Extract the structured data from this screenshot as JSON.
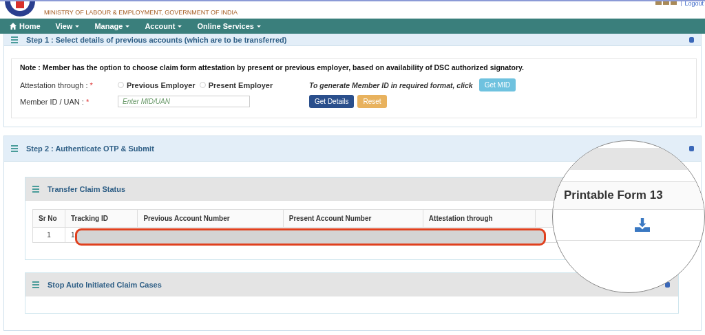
{
  "header": {
    "ministry": "MINISTRY OF LABOUR & EMPLOYMENT, GOVERNMENT OF INDIA",
    "logout": "Logout"
  },
  "nav": [
    {
      "label": "Home",
      "kind": "home"
    },
    {
      "label": "View",
      "kind": "dropdown"
    },
    {
      "label": "Manage",
      "kind": "dropdown"
    },
    {
      "label": "Account",
      "kind": "dropdown"
    },
    {
      "label": "Online Services",
      "kind": "dropdown"
    }
  ],
  "step1": {
    "title": "Step 1 : Select details of previous accounts (which are to be transferred)",
    "note": "Note : Member has the option to choose claim form attestation by present or previous employer, based on availability of DSC authorized signatory.",
    "attestation": {
      "label": "Attestation through :",
      "mark": "*",
      "options": [
        {
          "label": "Previous Employer",
          "selected": false
        },
        {
          "label": "Present Employer",
          "selected": false
        }
      ]
    },
    "member": {
      "label": "Member ID / UAN :",
      "mark": "*",
      "placeholder": "Enter MID/UAN"
    },
    "mid_hint": "To generate Member ID in required format, click",
    "buttons": [
      {
        "label": "Get MID",
        "kind": "info"
      },
      {
        "label": "Get Details",
        "kind": "primary"
      },
      {
        "label": "Reset",
        "kind": "warning"
      }
    ]
  },
  "step2": {
    "title": "Step 2 : Authenticate OTP & Submit",
    "status_panel": {
      "title": "Transfer Claim Status",
      "columns": [
        "Sr No",
        "Tracking ID",
        "Previous Account Number",
        "Present Account Number",
        "Attestation through"
      ],
      "rows": [
        {
          "sr_no": "1",
          "tracking_id": "1"
        }
      ]
    },
    "stop_panel": {
      "title": "Stop Auto Initiated Claim Cases"
    }
  },
  "magnifier": {
    "column": "Printable Form 13"
  }
}
